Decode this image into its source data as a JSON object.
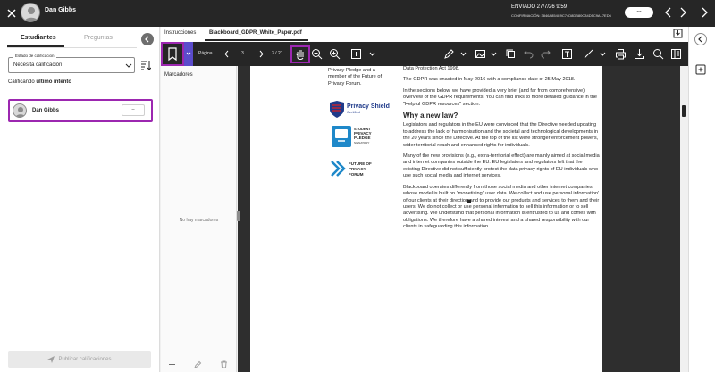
{
  "header": {
    "student_name": "Dan Gibbs",
    "submission_status": "ENVIADO 27/7/26 9:59",
    "confirmation": "CONFIRMACIÓN: 3846A854C9C74D8DB80C84D5C9A17ED6",
    "grade_pill": "--"
  },
  "left_panel": {
    "tabs": [
      "Estudiantes",
      "Preguntas"
    ],
    "grade_status_label": "Estado de calificación",
    "grade_status_value": "Necesita calificación",
    "grading_prefix": "Calificando",
    "grading_mode": "último intento",
    "students": [
      {
        "name": "Dan Gibbs",
        "grade": "--"
      }
    ],
    "post_grades_button": "Publicar calificaciones"
  },
  "doc_header": {
    "tabs": [
      "Instrucciones",
      "Blackboard_GDPR_White_Paper.pdf"
    ]
  },
  "pdf_toolbar": {
    "page_label": "Página",
    "current_page": "3",
    "page_total": "3 / 21"
  },
  "bookmarks": {
    "title": "Marcadores",
    "empty_text": "No hay marcadores"
  },
  "document": {
    "left_column_text": "Privacy Pledge and a member of the Future of Privacy Forum.",
    "logos": {
      "privacy_shield": {
        "line1": "Privacy Shield",
        "line2": "Certified"
      },
      "student_privacy_pledge": {
        "line1": "STUDENT",
        "line2": "PRIVACY",
        "line3": "PLEDGE",
        "line4": "SIGNATORY"
      },
      "future_privacy_forum": {
        "line1": "FUTURE OF",
        "line2": "PRIVACY",
        "line3": "FORUM"
      }
    },
    "paragraphs": [
      "Data Protection Act 1998.",
      "The GDPR was enacted in May 2016 with a compliance date of 25 May 2018.",
      "In the sections below, we have provided a very brief (and far from comprehensive) overview of the GDPR requirements. You can find links to more detailed guidance in the \"Helpful GDPR resources\" section."
    ],
    "heading": "Why a new law?",
    "paragraphs_after": [
      "Legislators and regulators in the EU were convinced that the Directive needed updating to address the lack of harmonisation and the societal and technological developments in the 20 years since the Directive. At the top of the list were stronger enforcement powers, wider territorial reach and enhanced rights for individuals.",
      "Many of the new provisions (e.g., extra-territorial effect) are mainly aimed at social media and internet companies outside the EU. EU legislators and regulators felt that the existing Directive did not sufficiently protect the data privacy rights of EU individuals who use such social media and internet services.",
      "Blackboard operates differently from those social media and other internet companies whose model is built on \"monetising\" user data. We collect and use personal information' of our clients at their direction and to provide our products and services to them and their users. We do not collect or use personal information to sell this information or to sell advertising. We understand that personal information is entrusted to us and comes with obligations. We therefore have a shared interest and a shared responsibility with our clients in safeguarding this information."
    ]
  },
  "colors": {
    "accent": "#9c27b0",
    "toolbar": "#262626",
    "bookmark_dropdown": "#5b4ccc"
  },
  "icons": [
    "close-icon",
    "avatar-icon",
    "chevron-left-icon",
    "chevron-right-icon",
    "sort-icon",
    "bookmark-icon",
    "zoom-out-icon",
    "zoom-in-icon",
    "fit-icon",
    "hand-icon",
    "pen-icon",
    "image-icon",
    "copy-icon",
    "undo-icon",
    "redo-icon",
    "text-icon",
    "line-icon",
    "print-icon",
    "download-icon",
    "search-icon",
    "sidebar-icon",
    "plus-icon",
    "edit-icon",
    "trash-icon",
    "add-comment-icon"
  ]
}
